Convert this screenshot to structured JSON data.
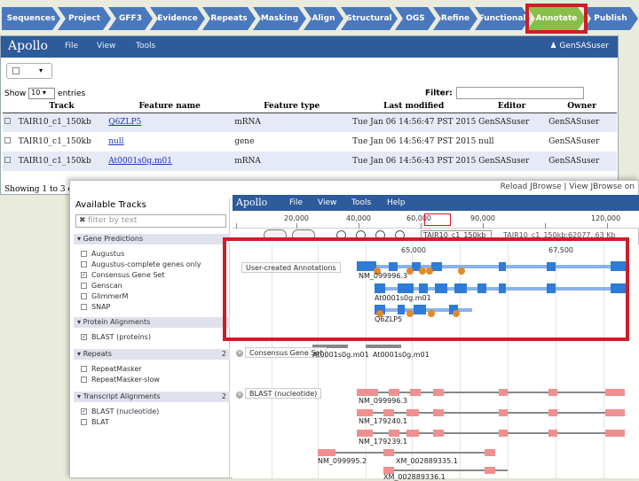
{
  "pipeline": {
    "steps": [
      "Sequences",
      "Project",
      "GFF3",
      "Evidence",
      "Repeats",
      "Masking",
      "Align",
      "Structural",
      "OGS",
      "Refine",
      "Functional",
      "Annotate",
      "Publish"
    ],
    "active": "Annotate"
  },
  "annotator": {
    "logo": "Apollo",
    "nav": [
      "File",
      "View",
      "Tools"
    ],
    "user": "GenSASuser",
    "show_prefix": "Show",
    "show_value": "10",
    "show_suffix": "entries",
    "filter_label": "Filter:",
    "columns": [
      "Track",
      "Feature name",
      "Feature type",
      "Last modified",
      "Editor",
      "Owner"
    ],
    "rows": [
      {
        "track": "TAIR10_c1_150kb",
        "name": "Q6ZLP5",
        "type": "mRNA",
        "modified": "Tue Jan 06 14:56:47 PST 2015",
        "editor": "GenSASuser",
        "owner": "GenSASuser"
      },
      {
        "track": "TAIR10_c1_150kb",
        "name": "null",
        "type": "gene",
        "modified": "Tue Jan 06 14:56:47 PST 2015",
        "editor": "null",
        "owner": "GenSASuser"
      },
      {
        "track": "TAIR10_c1_150kb",
        "name": "At0001s0g.m01",
        "type": "mRNA",
        "modified": "Tue Jan 06 14:56:43 PST 2015",
        "editor": "GenSASuser",
        "owner": "GenSASuser"
      }
    ],
    "showing": "Showing 1 to 3 of"
  },
  "jbrowse": {
    "top_links": "Reload JBrowse | View JBrowse on",
    "track_panel_title": "Available Tracks",
    "filter_placeholder": "filter by text",
    "categories": [
      {
        "name": "Gene Predictions",
        "count": "",
        "tracks": [
          {
            "label": "Augustus",
            "checked": false
          },
          {
            "label": "Augustus-complete genes only",
            "checked": false
          },
          {
            "label": "Consensus Gene Set",
            "checked": true
          },
          {
            "label": "Genscan",
            "checked": false
          },
          {
            "label": "GlimmerM",
            "checked": false
          },
          {
            "label": "SNAP",
            "checked": false
          }
        ]
      },
      {
        "name": "Protein Alignments",
        "count": "",
        "tracks": [
          {
            "label": "BLAST (proteins)",
            "checked": true
          }
        ]
      },
      {
        "name": "Repeats",
        "count": "2",
        "tracks": [
          {
            "label": "RepeatMasker",
            "checked": false
          },
          {
            "label": "RepeatMasker-slow",
            "checked": false
          }
        ]
      },
      {
        "name": "Transcript Alignments",
        "count": "2",
        "tracks": [
          {
            "label": "BLAST (nucleotide)",
            "checked": true
          },
          {
            "label": "BLAT",
            "checked": false
          }
        ]
      }
    ],
    "logo": "Apollo",
    "nav": [
      "File",
      "View",
      "Tools",
      "Help"
    ],
    "ruler_ticks": [
      "20,000",
      "40,000",
      "60,000",
      "90,000",
      "120,000"
    ],
    "sub_ticks": [
      "65,000",
      "67,500"
    ],
    "location": "TAIR10_c1_150kb",
    "location_info": "TAIR10_c1_150kb:62077..63 Kb",
    "track_labels": {
      "user_annotations": "User-created Annotations",
      "consensus": "Consensus Gene Set",
      "blast_nt": "BLAST (nucleotide)"
    },
    "feature_labels": {
      "f1": "NM_099996.3",
      "f2": "At0001s0g.m01",
      "f3": "Q6ZLP5",
      "f4": "At0001s0g.m01",
      "f5": "At0001s0g.m01",
      "b1": "NM_099996.3",
      "b2": "NM_179240.1",
      "b3": "NM_179239.1",
      "b4": "NM_099995.2",
      "b5": "XM_002889335.1",
      "b6": "XM_002889336.1"
    }
  }
}
